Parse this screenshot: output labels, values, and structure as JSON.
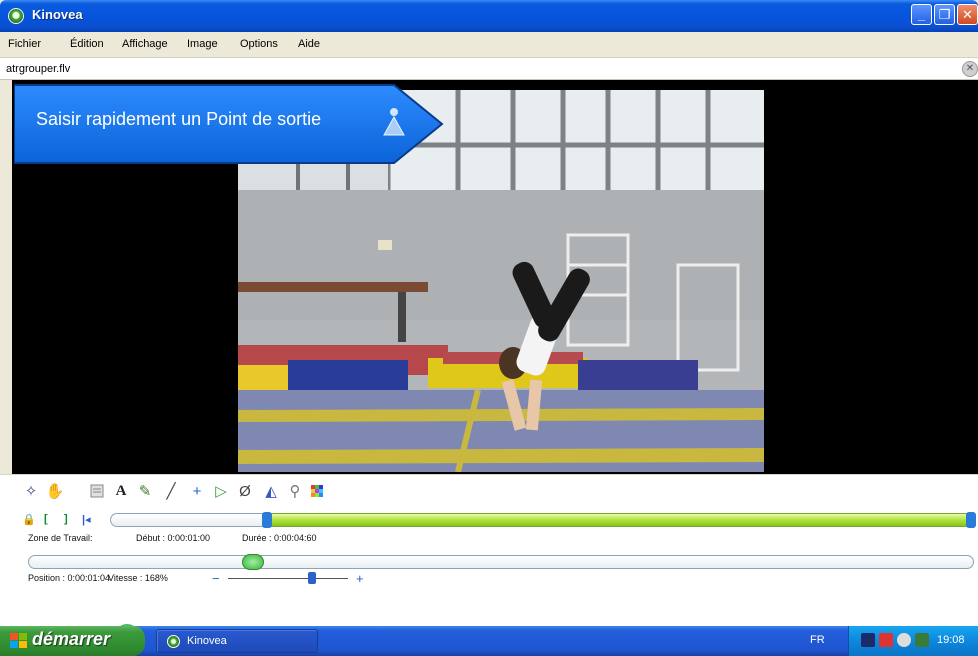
{
  "window": {
    "title": "Kinovea",
    "min_glyph": "_",
    "max_glyph": "❐",
    "close_glyph": "✕"
  },
  "menu": [
    "Fichier",
    "Édition",
    "Affichage",
    "Image",
    "Options",
    "Aide"
  ],
  "file": {
    "name": "atrgrouper.flv",
    "close_glyph": "✕"
  },
  "tooltip": {
    "text": "Saisir rapidement un Point de sortie"
  },
  "working_zone": {
    "label": "Zone de Travail:",
    "start": "Début : 0:00:01:00",
    "duration": "Durée : 0:00:04:60"
  },
  "playback": {
    "position": "Position : 0:00:01:04",
    "speed": "Vitesse : 168%",
    "speed_fraction": 0.7,
    "minus": "−",
    "plus": "+"
  },
  "taskbar": {
    "start_label": "démarrer",
    "task_label": "Kinovea",
    "language": "FR",
    "clock": "19:08"
  },
  "icons": {
    "drawing_tools": [
      "new-key-image-icon",
      "hand-icon",
      "comment-icon",
      "text-icon",
      "pencil-icon",
      "line-icon",
      "cross-marker-icon",
      "angle-icon",
      "chrono-icon",
      "grid-icon",
      "magnifier-icon",
      "color-profile-icon"
    ],
    "playback": [
      "first-frame-icon",
      "previous-frame-icon",
      "play-icon",
      "next-frame-icon",
      "last-frame-icon"
    ],
    "right": [
      "timecode-icon",
      "snapshot-icon",
      "save-video-icon",
      "presentation-icon"
    ]
  },
  "colors": {
    "titlebar": "#0754dd",
    "tooltip": "#1475f0",
    "zone_fill": "#aee33a",
    "play_button": "#1b9a4a",
    "taskbar": "#245edb",
    "start_button": "#3c9a3c"
  }
}
